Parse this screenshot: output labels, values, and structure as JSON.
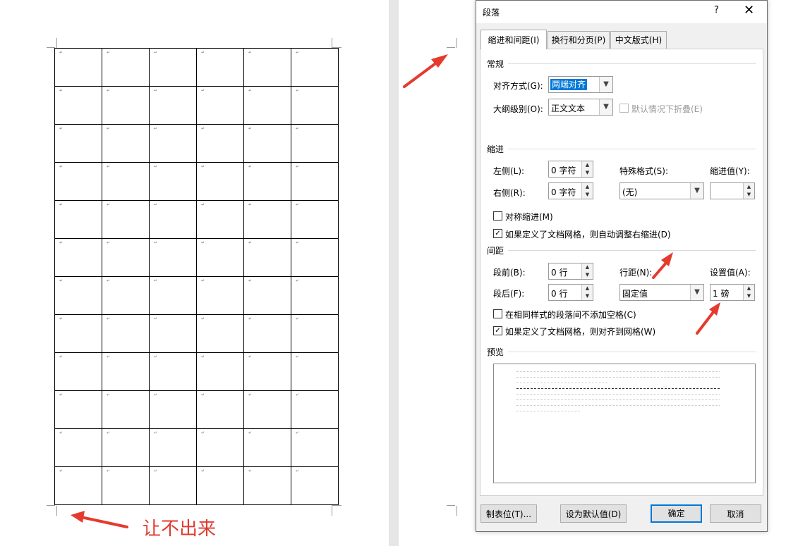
{
  "document": {
    "annotation_bottom": "让不出来",
    "table": {
      "rows": 12,
      "cols": 6,
      "cell_mark": "↵"
    }
  },
  "dialog": {
    "title": "段落",
    "help": "?",
    "close": "✕",
    "tabs": [
      {
        "label": "缩进和间距(I)",
        "active": true
      },
      {
        "label": "换行和分页(P)",
        "active": false
      },
      {
        "label": "中文版式(H)",
        "active": false
      }
    ],
    "general": {
      "title": "常规",
      "alignment_label": "对齐方式(G):",
      "alignment_value": "两端对齐",
      "outline_label": "大纲级别(O):",
      "outline_value": "正文文本",
      "collapse_label": "默认情况下折叠(E)",
      "collapse_checked": false
    },
    "indent": {
      "title": "缩进",
      "left_label": "左侧(L):",
      "left_value": "0 字符",
      "right_label": "右侧(R):",
      "right_value": "0 字符",
      "special_label": "特殊格式(S):",
      "special_value": "(无)",
      "indent_by_label": "缩进值(Y):",
      "indent_by_value": "",
      "mirror_label": "对称缩进(M)",
      "mirror_checked": false,
      "auto_adjust_label": "如果定义了文档网格，则自动调整右缩进(D)",
      "auto_adjust_checked": true
    },
    "spacing": {
      "title": "间距",
      "before_label": "段前(B):",
      "before_value": "0 行",
      "after_label": "段后(F):",
      "after_value": "0 行",
      "line_spacing_label": "行距(N):",
      "line_spacing_value": "固定值",
      "at_label": "设置值(A):",
      "at_value": "1 磅",
      "no_space_label": "在相同样式的段落间不添加空格(C)",
      "no_space_checked": false,
      "snap_grid_label": "如果定义了文档网格，则对齐到网格(W)",
      "snap_grid_checked": true
    },
    "preview": {
      "title": "预览"
    },
    "buttons": {
      "tabs": "制表位(T)...",
      "set_default": "设为默认值(D)",
      "ok": "确定",
      "cancel": "取消"
    },
    "checkmark": "✓",
    "dropdown_arrow": "▼",
    "spin_up": "▲",
    "spin_down": "▼"
  },
  "colors": {
    "annotation_red": "#e03a2f",
    "selection_blue": "#0078d7"
  }
}
